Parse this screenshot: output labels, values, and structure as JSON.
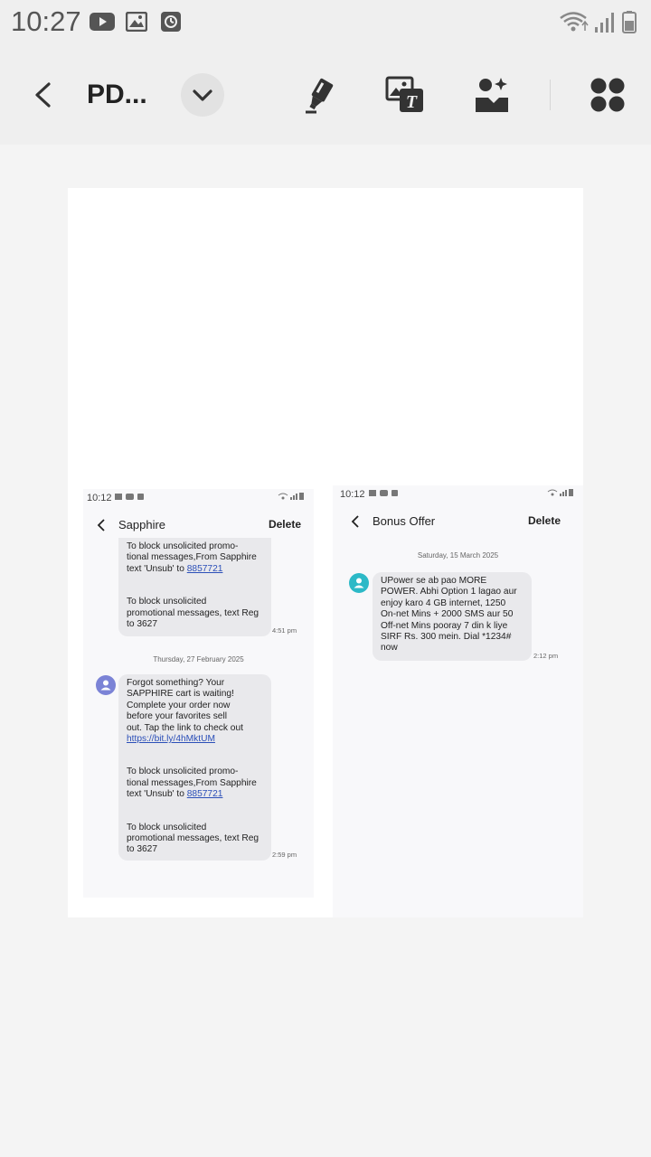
{
  "status_bar": {
    "time": "10:27"
  },
  "toolbar": {
    "title": "PD..."
  },
  "left_shot": {
    "status_time": "10:12",
    "contact": "Sapphire",
    "delete_label": "Delete",
    "msg1": {
      "lines_a": "To block unsolicited promo-\ntional messages,From Sapphire",
      "text_unsub": "text 'Unsub' to ",
      "number": "8857721",
      "lines_b": "To block unsolicited\npromotional messages, text Reg\nto 3627",
      "time": "4:51 pm"
    },
    "date_sep": "Thursday, 27 February 2025",
    "msg2": {
      "lines_a": "Forgot something? Your\nSAPPHIRE cart is waiting!\nComplete your order now\nbefore your favorites sell\nout. Tap the link to check out",
      "link": "https://bit.ly/4hMktUM",
      "lines_b": "To block unsolicited promo-\ntional messages,From Sapphire",
      "text_unsub": "text 'Unsub' to ",
      "number": "8857721",
      "lines_c": "To block unsolicited\npromotional messages, text Reg\nto 3627",
      "time": "2:59 pm"
    },
    "avatar_color": "#7b83d6"
  },
  "right_shot": {
    "status_time": "10:12",
    "contact": "Bonus Offer",
    "delete_label": "Delete",
    "date_sep": "Saturday, 15 March 2025",
    "msg": {
      "text": "UPower se ab pao MORE\nPOWER. Abhi Option 1 lagao aur\nenjoy karo 4 GB internet, 1250\nOn-net Mins + 2000 SMS aur 50\nOff-net Mins pooray 7 din k liye\nSIRF Rs. 300 mein. Dial *1234#\nnow",
      "time": "2:12 pm"
    },
    "avatar_color": "#2cb9c7"
  }
}
